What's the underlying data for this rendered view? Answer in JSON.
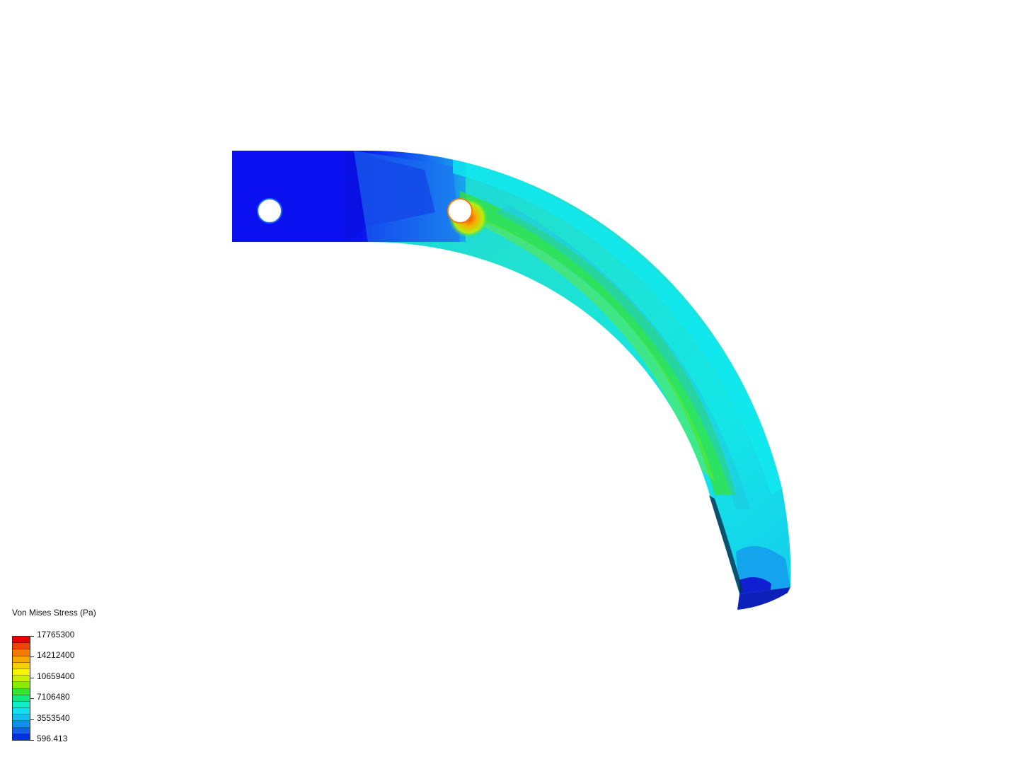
{
  "legend": {
    "title": "Von Mises Stress (Pa)",
    "labels": [
      "17765300",
      "14212400",
      "10659400",
      "7106480",
      "3553540",
      "596.413"
    ],
    "band_colors": [
      "#e60000",
      "#ee4400",
      "#f57a00",
      "#f8a800",
      "#f5d000",
      "#f5f500",
      "#c8f000",
      "#88ec00",
      "#33e433",
      "#10e880",
      "#10f0c8",
      "#10e0f0",
      "#10bff0",
      "#1090ee",
      "#1060e8",
      "#0030e0"
    ]
  },
  "model": {
    "hole_color": "#ffffff",
    "base_color": "#0a14f0",
    "arc_color": "#14d8e8",
    "hot_color": "#f0a010",
    "green_color": "#36e236"
  }
}
